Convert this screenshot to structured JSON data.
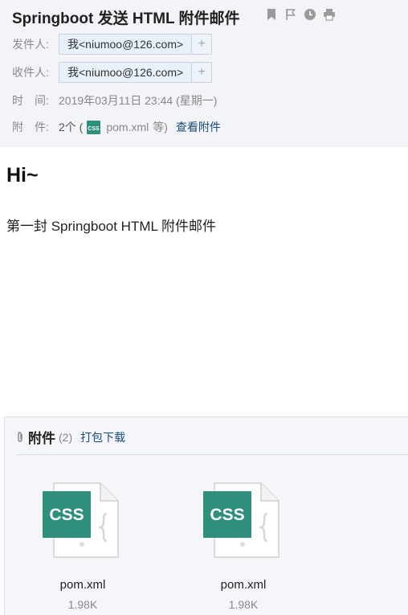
{
  "header": {
    "subject": "Springboot 发送 HTML 附件邮件",
    "icons": [
      "bookmark-icon",
      "flag-icon",
      "clock-icon",
      "print-icon"
    ],
    "from_label": "发件人:",
    "from_value": "我<niumoo@126.com>",
    "to_label": "收件人:",
    "to_value": "我<niumoo@126.com>",
    "plus": "+",
    "time_label": "时　间:",
    "time_value": "2019年03月11日 23:44 (星期一)",
    "attach_label": "附　件:",
    "attach_count": "2个 (",
    "attach_file": "pom.xml",
    "attach_suffix": "等)",
    "view_link": "查看附件"
  },
  "body": {
    "greeting": "Hi~",
    "text": "第一封 Springboot HTML 附件邮件"
  },
  "attachments": {
    "title": "附件",
    "count": "(2)",
    "download_all": "打包下载",
    "files": [
      {
        "name": "pom.xml",
        "size": "1.98K",
        "badge": "CSS"
      },
      {
        "name": "pom.xml",
        "size": "1.98K",
        "badge": "CSS"
      }
    ]
  },
  "colors": {
    "css_badge": "#2e8f7c",
    "link": "#1b4c7d",
    "header_bg": "#f2f4f7"
  }
}
